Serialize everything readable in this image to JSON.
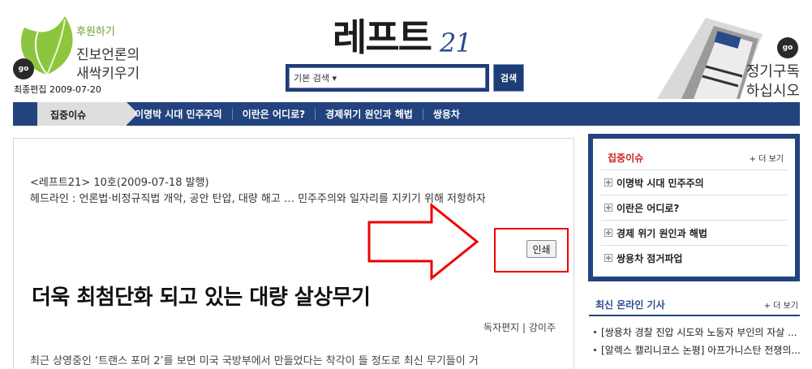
{
  "header": {
    "left_promo": {
      "slogan": "후원하기",
      "line1": "진보언론의",
      "line2": "새싹키우기",
      "go": "go"
    },
    "edit_date": "최종편집 2009-07-20",
    "logo": {
      "text": "레프트",
      "number": "21"
    },
    "search": {
      "value": "기본 검색 ▾",
      "button": "검색"
    },
    "right_promo": {
      "line1": "정기구독",
      "line2": "하십시오",
      "go": "go"
    }
  },
  "nav": {
    "active": "집중이슈",
    "items": [
      "이명박 시대 민주주의",
      "이란은 어디로?",
      "경제위기 원인과 해법",
      "쌍용차"
    ]
  },
  "article": {
    "meta": "<레프트21> 10호(2009-07-18 발행)",
    "headline": "헤드라인 : 언론법·비정규직법 개악, 공안 탄압, 대량 해고 … 민주주의와 일자리를 지키기 위해 저항하자",
    "print_button": "인쇄",
    "title": "더욱 최첨단화 되고 있는 대량 살상무기",
    "byline": "독자편지 | 강이주",
    "body": "최근 상영중인 ‘트랜스 포머 2’를 보면 미국 국방부에서 만들었다는 착각이 들 정도로 최신 무기들이 거"
  },
  "sidebar": {
    "focus": {
      "title": "집중이슈",
      "more": "+ 더 보기",
      "items": [
        "이명박 시대 민주주의",
        "이란은 어디로?",
        "경제 위기 원인과 해법",
        "쌍용차 점거파업"
      ]
    },
    "latest": {
      "title": "최신 온라인 기사",
      "more": "+ 더 보기",
      "items": [
        "[쌍용차 경찰 진압 시도와 노동자 부인의 자살 ...",
        "[알렉스 캘리니코스 논평] 아프가니스탄 전쟁의..."
      ]
    }
  },
  "colors": {
    "navy": "#22437d",
    "highlight_red": "#e00000",
    "leaf_green": "#6aa02a"
  }
}
